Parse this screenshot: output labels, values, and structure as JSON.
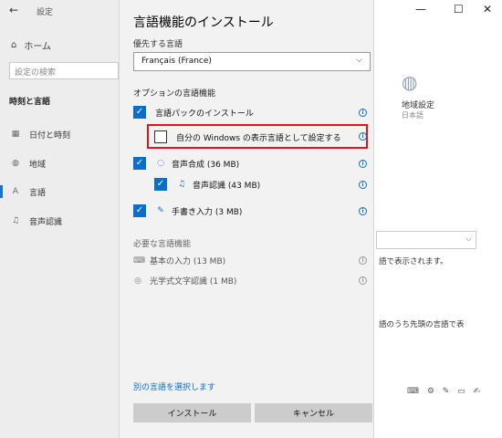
{
  "window": {
    "app_title": "設定",
    "minimize": "—",
    "maximize": "☐",
    "close": "✕",
    "back": "←"
  },
  "sidebar": {
    "home": "ホーム",
    "search_placeholder": "設定の検索",
    "section": "時刻と言語",
    "items": [
      {
        "label": "日付と時刻",
        "icon": "calendar-icon",
        "glyph": "▦"
      },
      {
        "label": "地域",
        "icon": "globe-icon",
        "glyph": "◍"
      },
      {
        "label": "言語",
        "icon": "language-icon",
        "glyph": "A"
      },
      {
        "label": "音声認識",
        "icon": "microphone-icon",
        "glyph": "♫"
      }
    ]
  },
  "background": {
    "region_title": "地域設定",
    "region_sub": "日本語",
    "text1": "語で表示されます。",
    "text2": "語のうち先頭の言語で表",
    "icons": "⌨ ⚙ ✎ ▭ ✍"
  },
  "dialog": {
    "title": "言語機能のインストール",
    "preferred_label": "優先する言語",
    "selected_language": "Français (France)",
    "optional_label": "オプションの言語機能",
    "features": [
      {
        "label": "言語パックのインストール",
        "checked": true
      },
      {
        "label": "自分の Windows の表示言語として設定する",
        "checked": false
      },
      {
        "label": "音声合成 (36 MB)",
        "checked": true
      },
      {
        "label": "音声認識 (43 MB)",
        "checked": true
      },
      {
        "label": "手書き入力 (3 MB)",
        "checked": true
      }
    ],
    "required_label": "必要な言語機能",
    "required": [
      {
        "label": "基本の入力 (13 MB)"
      },
      {
        "label": "光学式文字認識 (1 MB)"
      }
    ],
    "choose_link": "別の言語を選択します",
    "install_button": "インストール",
    "cancel_button": "キャンセル"
  },
  "colors": {
    "accent": "#0a6fc9",
    "highlight": "#e0161d"
  }
}
